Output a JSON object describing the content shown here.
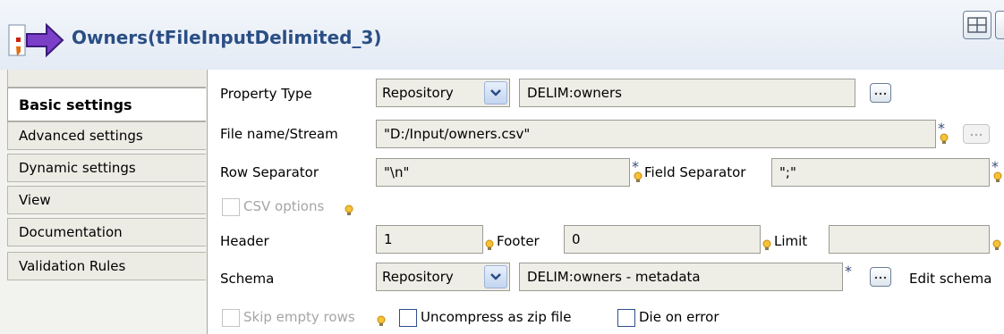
{
  "header": {
    "title": "Owners(tFileInputDelimited_3)"
  },
  "tabs": [
    "Basic settings",
    "Advanced settings",
    "Dynamic settings",
    "View",
    "Documentation",
    "Validation Rules"
  ],
  "form": {
    "property_type_label": "Property Type",
    "property_type_value": "Repository",
    "property_repo_value": "DELIM:owners",
    "file_label": "File name/Stream",
    "file_value": "\"D:/Input/owners.csv\"",
    "row_sep_label": "Row Separator",
    "row_sep_value": "\"\\n\"",
    "field_sep_label": "Field Separator",
    "field_sep_value": "\";\"",
    "csv_options_label": "CSV options",
    "header_label": "Header",
    "header_value": "1",
    "footer_label": "Footer",
    "footer_value": "0",
    "limit_label": "Limit",
    "limit_value": "",
    "schema_label": "Schema",
    "schema_type_value": "Repository",
    "schema_repo_value": "DELIM:owners - metadata",
    "edit_schema_label": "Edit schema",
    "skip_empty_label": "Skip empty rows",
    "uncompress_label": "Uncompress as zip file",
    "die_on_error_label": "Die on error"
  },
  "colors": {
    "title": "#2a4e85",
    "accent": "#3a4d78"
  }
}
